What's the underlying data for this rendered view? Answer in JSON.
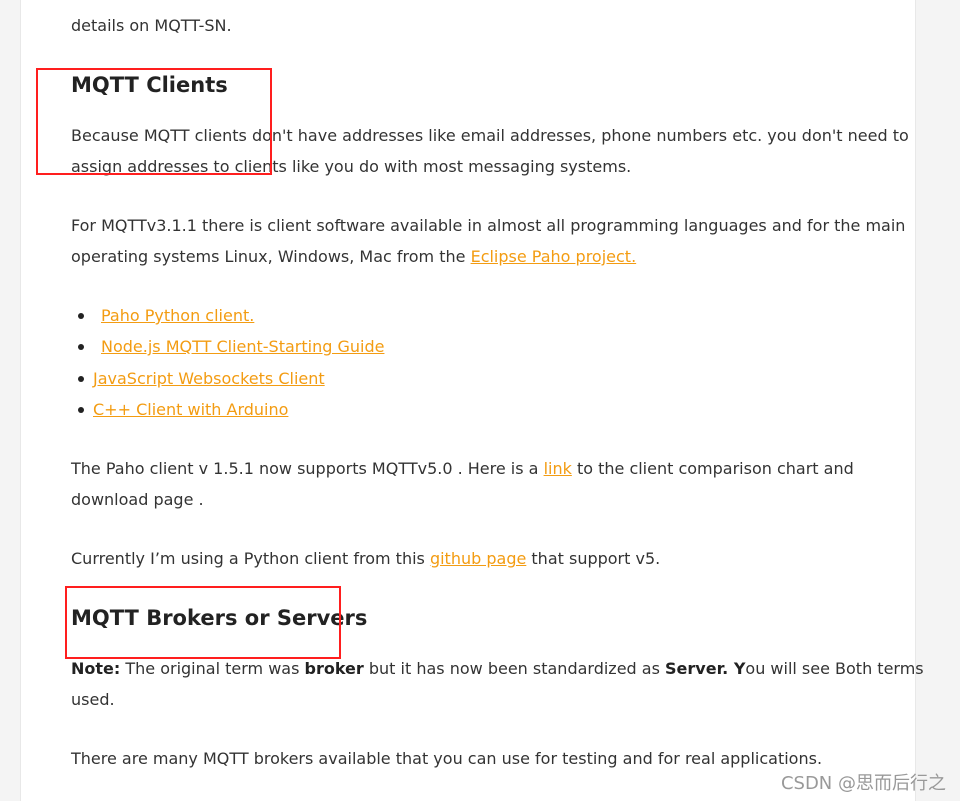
{
  "top": {
    "cut_line_text": "",
    "line2": "details on MQTT-SN."
  },
  "clients": {
    "heading": "MQTT Clients",
    "para1_line1": "Because MQTT clients don't have addresses like email addresses, phone numbers etc. you don't need to",
    "para1_line2": "assign addresses to clients like you do with most messaging systems.",
    "para2_line1": "For MQTTv3.1.1 there is client software available in almost all programming languages and for the main",
    "para2_line2_prefix": "operating systems Linux, Windows, Mac from the ",
    "para2_link": "Eclipse Paho project.",
    "list": [
      "Paho Python client.",
      "Node.js MQTT Client-Starting Guide",
      "JavaScript Websockets Client",
      "C++ Client with Arduino"
    ],
    "para3_prefix": "The Paho client v 1.5.1 now supports MQTTv5.0 . Here is a ",
    "para3_link": "link",
    "para3_suffix": " to the client comparison chart and",
    "para3_line2": "download page .",
    "para4_prefix": "Currently I’m using a Python client from this ",
    "para4_link": "github page",
    "para4_suffix": " that support v5."
  },
  "brokers": {
    "heading": "MQTT Brokers or Servers",
    "note_label": "Note:",
    "note_text1": " The original term was ",
    "note_bold1": "broker",
    "note_text2": " but it has now been standardized as ",
    "note_bold2": "Server. Y",
    "note_text3": "ou will see Both terms",
    "note_line2": "used.",
    "para_last": "There are many MQTT brokers available that you can use for testing and for real applications."
  },
  "watermark": "CSDN @思而后行之",
  "colors": {
    "link": "#f39c12",
    "highlight_box": "#ff1e1e",
    "text": "#333333"
  }
}
